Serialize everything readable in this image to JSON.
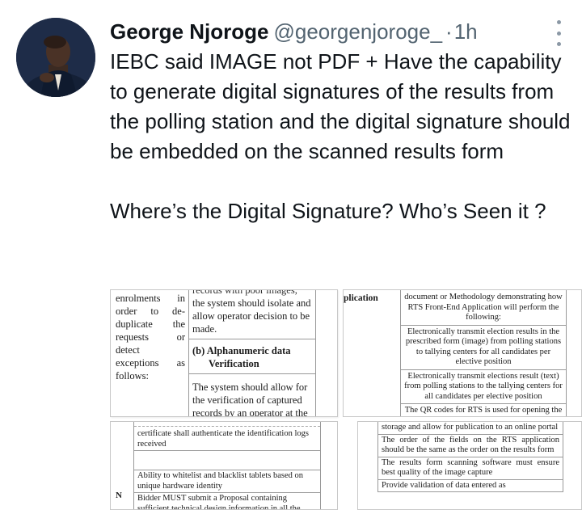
{
  "tweet": {
    "author_name": "George Njoroge",
    "author_handle": "@georgenjoroge_",
    "separator": "·",
    "timestamp": "1h",
    "more_icon": "more-vertical-icon",
    "paragraph_1": "IEBC said IMAGE not PDF + Have the capability to generate digital signatures of the results from the polling station and the digital signature should be embedded on the scanned results form",
    "paragraph_2": "Where’s the Digital Signature? Who’s Seen it ?"
  },
  "media": {
    "top_left": {
      "col1": "enrolments in order to de-duplicate the requests or detect exceptions as follows:",
      "col2_cut": "records with poor images,",
      "col2_top": "the system should isolate and allow operator decision to be made.",
      "col2_heading": "(b) Alphanumeric data",
      "col2_subheading": "Verification",
      "col2_body": "The system should allow for the verification of captured records by an operator at the"
    },
    "top_right": {
      "label": "plication",
      "rows": [
        "document or Methodology demonstrating how RTS Front-End Application will perform the following:",
        "Electronically transmit election results in the prescribed form (image) from polling stations to tallying centers for all candidates per elective position",
        "Electronically transmit elections result (text) from polling stations to the tallying centers for all candidates per elective position",
        "The QR codes for RTS is used for opening the results transmission application and thus"
      ]
    },
    "bottom_left": {
      "lead": "N",
      "rows": [
        "certificate shall authenticate the identification logs received",
        "",
        "Ability to whitelist and blacklist tablets based on unique hardware identity",
        "Bidder MUST submit a Proposal containing sufficient technical design information in all the following requirements:"
      ]
    },
    "bottom_right": {
      "rows": [
        "storage and allow for publication to an online portal",
        "The order of the fields on the RTS application should be the same as the order on the results form",
        "The results form scanning software must ensure best quality of the image capture",
        "Provide validation of data entered as"
      ]
    }
  }
}
